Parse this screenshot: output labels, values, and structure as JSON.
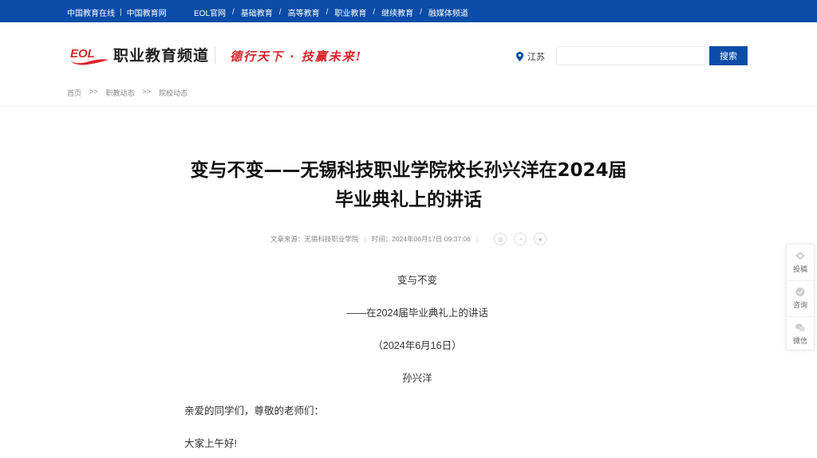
{
  "topbar": {
    "left_links": [
      "中国教育在线",
      "中国教育网"
    ],
    "nav": [
      "EOL官网",
      "基础教育",
      "高等教育",
      "职业教育",
      "继续教育",
      "融媒体频道"
    ]
  },
  "header": {
    "logo_mark": "EOL",
    "logo_text": "职业教育频道",
    "slogan": "德行天下 · 技赢未来!",
    "location": "江苏",
    "search_value": "",
    "search_button": "搜索"
  },
  "breadcrumb": [
    "首页",
    "职教动态",
    "院校动态"
  ],
  "breadcrumb_separator": ">>",
  "article": {
    "title_line1": "变与不变——无锡科技职业学院校长孙兴洋在2024届",
    "title_line2": "毕业典礼上的讲话",
    "source": "文章来源：无锡科技职业学院",
    "time": "时间：2024年06月17日 09:37:06",
    "body": {
      "heading": "变与不变",
      "subheading": "——在2024届毕业典礼上的讲话",
      "date": "（2024年6月16日）",
      "author": "孙兴洋",
      "greeting": "亲爱的同学们，尊敬的老师们：",
      "hello": "大家上午好!"
    }
  },
  "float_bar": [
    "投稿",
    "咨询",
    "微信"
  ],
  "colors": {
    "brand_blue": "#0a4ca8",
    "slogan_red": "#d8252a"
  }
}
